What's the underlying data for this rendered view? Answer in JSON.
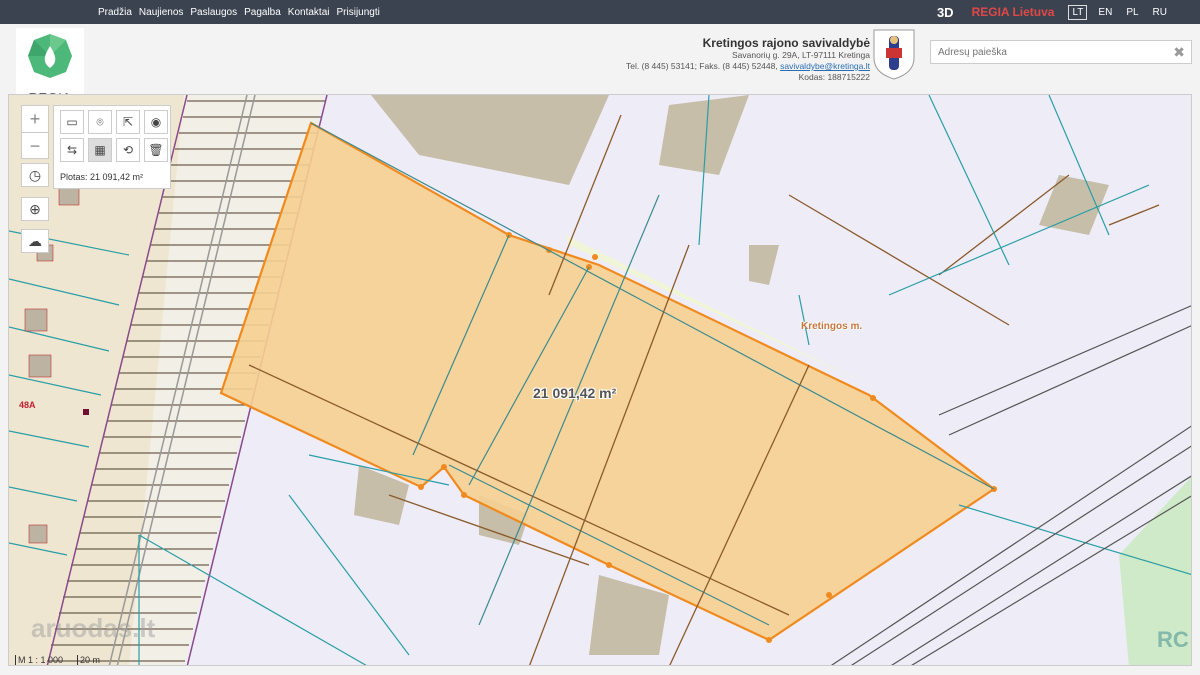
{
  "topnav": {
    "items": [
      "Pradžia",
      "Naujienos",
      "Paslaugos",
      "Pagalba",
      "Kontaktai",
      "Prisijungti"
    ],
    "btn_3d": "3D",
    "regia_lietuva": "REGIA Lietuva",
    "languages": [
      "LT",
      "EN",
      "PL",
      "RU"
    ],
    "active_language": "LT"
  },
  "logo": {
    "text": "REGIA"
  },
  "municipality": {
    "name": "Kretingos rajono savivaldybė",
    "address": "Savanorių g. 29A, LT-97111 Kretinga",
    "contact_prefix": "Tel. (8 445) 53141; Faks. (8 445) 52448, ",
    "email": "savivaldybe@kretinga.lt",
    "code": "Kodas: 188715222"
  },
  "search": {
    "placeholder": "Adresų paieška",
    "clear_icon": "close-icon"
  },
  "map": {
    "measure_text": "Plotas: 21 091,42 m²",
    "area_label": "21 091,42 m²",
    "place_label": "Kretingos m.",
    "address_label": "48A",
    "scale_ratio": "M 1 : 1 000",
    "scale_distance": "20 m",
    "watermark": "aruodas.lt",
    "colors": {
      "parcel_fill": "#f5cf90",
      "parcel_stroke": "#f08a1e",
      "background": "#eeedf7"
    }
  },
  "tools": {
    "zoom_in": "+",
    "zoom_out": "−",
    "icons": [
      "measure-length-icon",
      "marker-icon",
      "export-icon",
      "target-icon",
      "measure-distance-icon",
      "measure-area-icon",
      "history-icon",
      "delete-icon",
      "clock-icon",
      "locate-icon",
      "cloud-icon"
    ]
  }
}
